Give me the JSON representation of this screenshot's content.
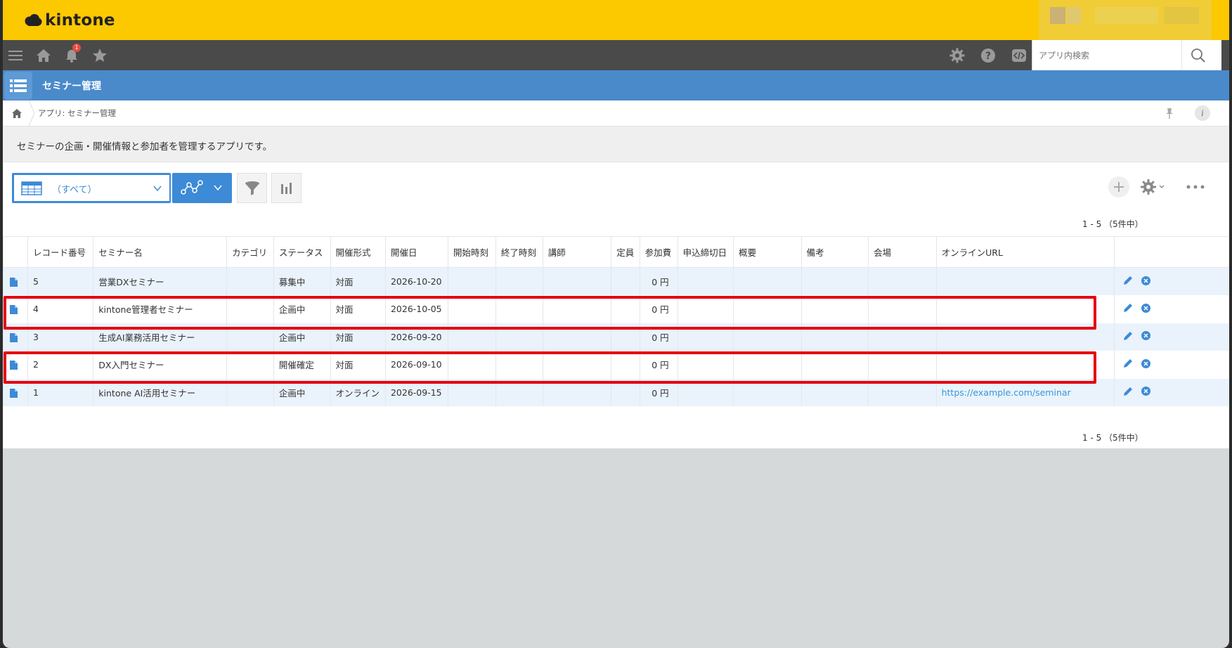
{
  "header": {
    "logo_text": "kintone",
    "notification_count": "1"
  },
  "search": {
    "placeholder": "アプリ内検索"
  },
  "app": {
    "title": "セミナー管理"
  },
  "breadcrumb": {
    "text": "アプリ: セミナー管理"
  },
  "description": "セミナーの企画・開催情報と参加者を管理するアプリです。",
  "toolbar": {
    "view_label": "（すべて）"
  },
  "pagination": {
    "top": "1 - 5 （5件中）",
    "bottom": "1 - 5 （5件中）"
  },
  "table": {
    "columns": [
      "レコード番号",
      "セミナー名",
      "カテゴリ",
      "ステータス",
      "開催形式",
      "開催日",
      "開始時刻",
      "終了時刻",
      "講師",
      "定員",
      "参加費",
      "申込締切日",
      "概要",
      "備考",
      "会場",
      "オンラインURL"
    ],
    "rows": [
      {
        "id": "5",
        "name": "営業DXセミナー",
        "category": "",
        "status": "募集中",
        "format": "対面",
        "date": "2026-10-20",
        "start": "",
        "end": "",
        "lecturer": "",
        "capacity": "",
        "fee": "0 円",
        "deadline": "",
        "summary": "",
        "notes": "",
        "venue": "",
        "url": ""
      },
      {
        "id": "4",
        "name": "kintone管理者セミナー",
        "category": "",
        "status": "企画中",
        "format": "対面",
        "date": "2026-10-05",
        "start": "",
        "end": "",
        "lecturer": "",
        "capacity": "",
        "fee": "0 円",
        "deadline": "",
        "summary": "",
        "notes": "",
        "venue": "",
        "url": ""
      },
      {
        "id": "3",
        "name": "生成AI業務活用セミナー",
        "category": "",
        "status": "企画中",
        "format": "対面",
        "date": "2026-09-20",
        "start": "",
        "end": "",
        "lecturer": "",
        "capacity": "",
        "fee": "0 円",
        "deadline": "",
        "summary": "",
        "notes": "",
        "venue": "",
        "url": ""
      },
      {
        "id": "2",
        "name": "DX入門セミナー",
        "category": "",
        "status": "開催確定",
        "format": "対面",
        "date": "2026-09-10",
        "start": "",
        "end": "",
        "lecturer": "",
        "capacity": "",
        "fee": "0 円",
        "deadline": "",
        "summary": "",
        "notes": "",
        "venue": "",
        "url": ""
      },
      {
        "id": "1",
        "name": "kintone AI活用セミナー",
        "category": "",
        "status": "企画中",
        "format": "オンライン",
        "date": "2026-09-15",
        "start": "",
        "end": "",
        "lecturer": "",
        "capacity": "",
        "fee": "0 円",
        "deadline": "",
        "summary": "",
        "notes": "",
        "venue": "",
        "url": "https://example.com/seminar"
      }
    ]
  },
  "colors": {
    "brand_yellow": "#fcc800",
    "nav_dark": "#4a4a4a",
    "app_blue": "#4a8acb",
    "accent_blue": "#3d8ad6",
    "row_stripe": "#eaf3fb",
    "highlight_red": "#e60012",
    "link": "#3498db"
  },
  "icons": {
    "logo": "kintone-cloud-icon",
    "menu": "hamburger-icon",
    "home": "home-icon",
    "notifications": "bell-icon",
    "favorites": "star-icon",
    "settings": "gear-icon",
    "help": "help-icon",
    "dev": "code-icon",
    "search": "search-icon",
    "record": "document-icon",
    "edit": "pencil-icon",
    "delete": "close-circle-icon"
  }
}
